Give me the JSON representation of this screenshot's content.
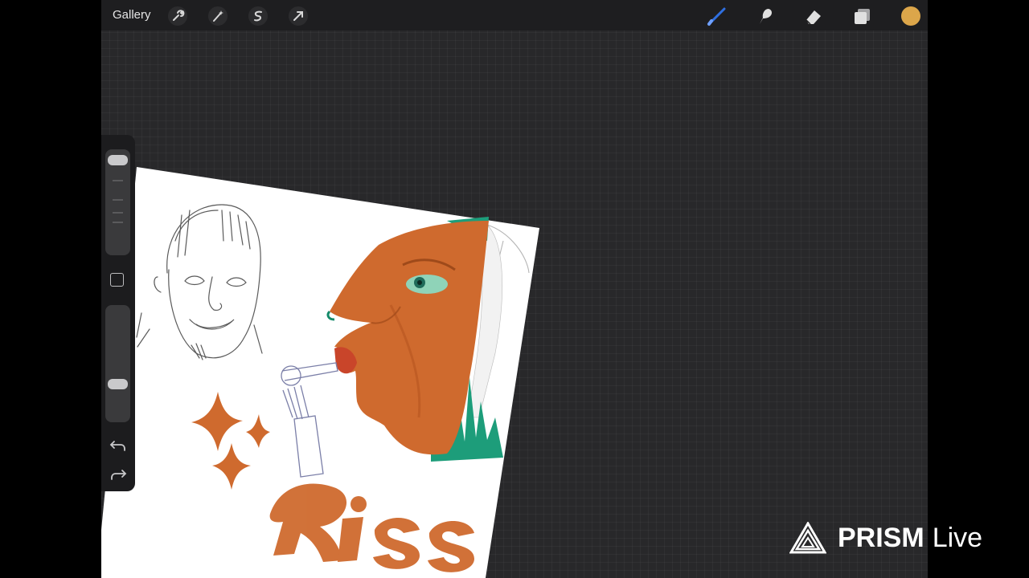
{
  "toolbar": {
    "gallery_label": "Gallery",
    "left_icons": [
      "wrench-icon",
      "magic-wand-icon",
      "selection-s-icon",
      "transform-arrow-icon"
    ],
    "right_icons": [
      "brush-icon",
      "smudge-icon",
      "eraser-icon",
      "layers-icon",
      "color-swatch-icon"
    ],
    "active_tool": "brush",
    "brush_accent_color": "#2f6fe0",
    "current_color": "#dca64a"
  },
  "sidebar": {
    "brush_size_slider_level": 0.0,
    "opacity_slider_level": 1.0,
    "icons": [
      "modify-square-icon",
      "undo-icon",
      "redo-icon"
    ]
  },
  "canvas": {
    "art_text": "Riss",
    "workspace_color": "#28282a"
  },
  "watermark": {
    "brand": "PRISM",
    "suffix": "Live"
  }
}
